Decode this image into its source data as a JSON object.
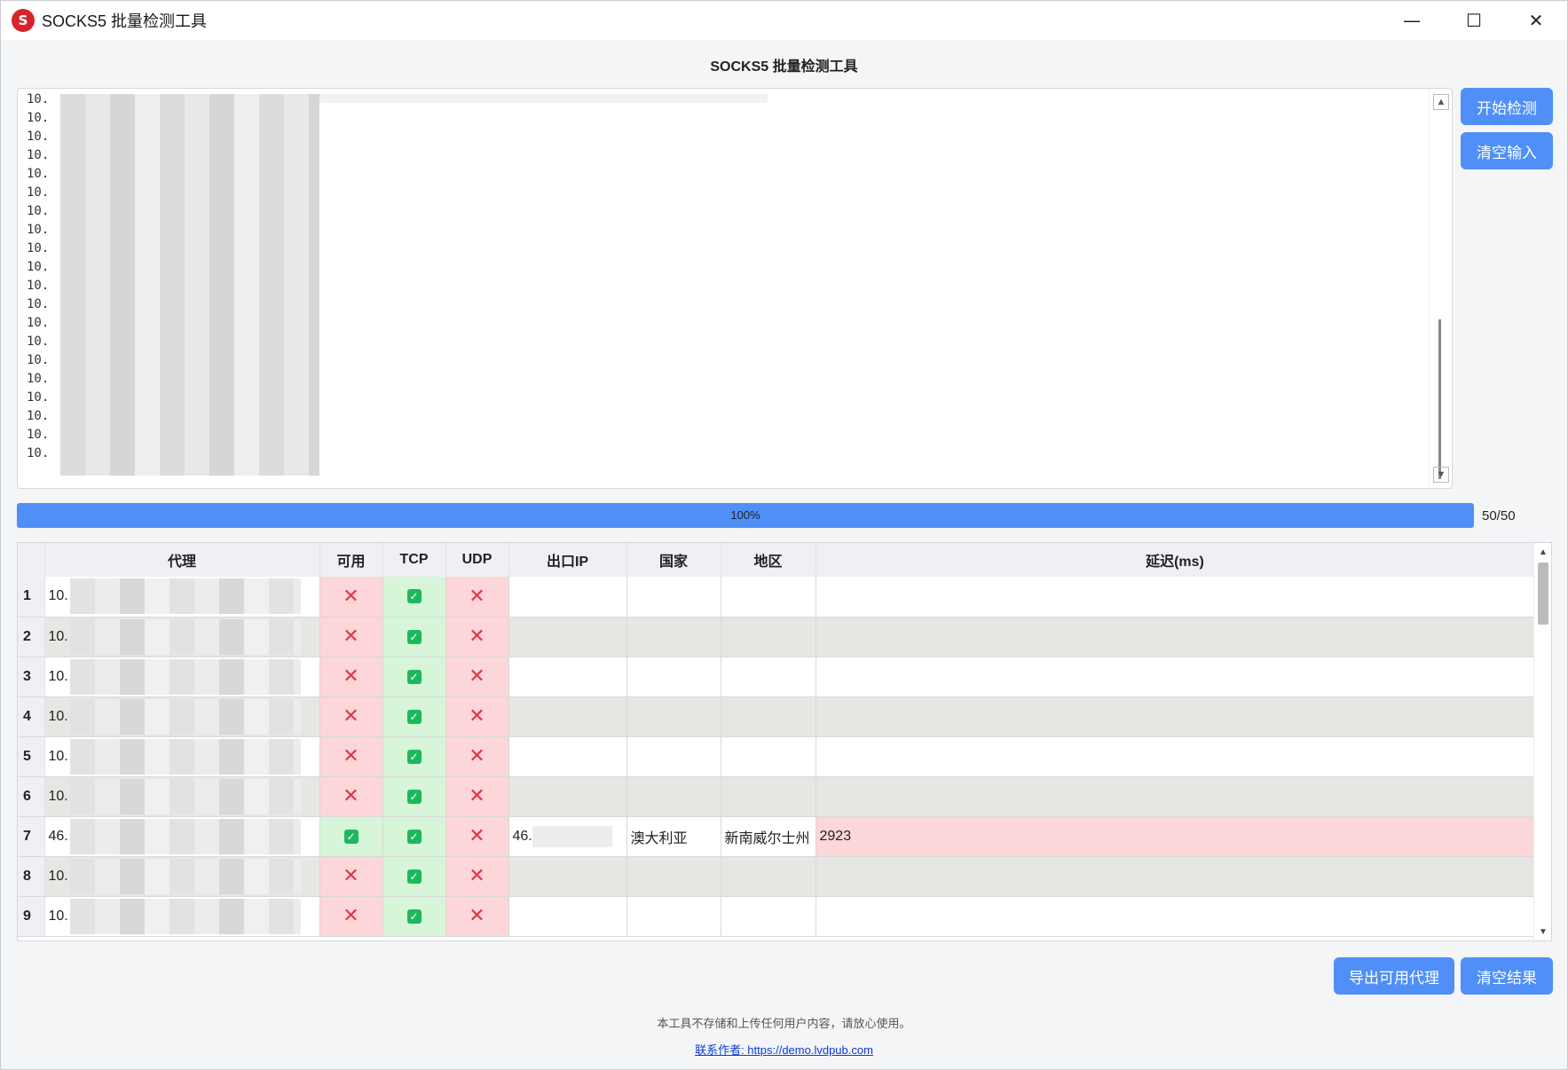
{
  "window": {
    "title": "SOCKS5 批量检测工具",
    "app_icon": "socks-logo-icon",
    "controls": {
      "minimize": "—",
      "maximize": "☐",
      "close": "✕"
    }
  },
  "heading": "SOCKS5 批量检测工具",
  "input": {
    "line_prefix": "10.",
    "line_count": 20
  },
  "buttons": {
    "start": "开始检测",
    "clear_input": "清空输入",
    "export": "导出可用代理",
    "clear_results": "清空结果"
  },
  "progress": {
    "percent_text": "100%",
    "value": 1.0,
    "count_text": "50/50"
  },
  "table": {
    "headers": [
      "代理",
      "可用",
      "TCP",
      "UDP",
      "出口IP",
      "国家",
      "地区",
      "延迟(ms)"
    ],
    "rows": [
      {
        "num": "1",
        "proxy": "10.",
        "available": false,
        "tcp": true,
        "udp": false,
        "exit_ip": "",
        "country": "",
        "region": "",
        "latency": ""
      },
      {
        "num": "2",
        "proxy": "10.",
        "available": false,
        "tcp": true,
        "udp": false,
        "exit_ip": "",
        "country": "",
        "region": "",
        "latency": ""
      },
      {
        "num": "3",
        "proxy": "10.",
        "available": false,
        "tcp": true,
        "udp": false,
        "exit_ip": "",
        "country": "",
        "region": "",
        "latency": ""
      },
      {
        "num": "4",
        "proxy": "10.",
        "available": false,
        "tcp": true,
        "udp": false,
        "exit_ip": "",
        "country": "",
        "region": "",
        "latency": ""
      },
      {
        "num": "5",
        "proxy": "10.",
        "available": false,
        "tcp": true,
        "udp": false,
        "exit_ip": "",
        "country": "",
        "region": "",
        "latency": ""
      },
      {
        "num": "6",
        "proxy": "10.",
        "available": false,
        "tcp": true,
        "udp": false,
        "exit_ip": "",
        "country": "",
        "region": "",
        "latency": ""
      },
      {
        "num": "7",
        "proxy": "46.",
        "available": true,
        "tcp": true,
        "udp": false,
        "exit_ip": "46.",
        "country": "澳大利亚",
        "region": "新南威尔士州",
        "latency": "2923"
      },
      {
        "num": "8",
        "proxy": "10.",
        "available": false,
        "tcp": true,
        "udp": false,
        "exit_ip": "",
        "country": "",
        "region": "",
        "latency": ""
      },
      {
        "num": "9",
        "proxy": "10.",
        "available": false,
        "tcp": true,
        "udp": false,
        "exit_ip": "",
        "country": "",
        "region": "",
        "latency": ""
      }
    ]
  },
  "footer": {
    "note": "本工具不存储和上传任何用户内容，请放心使用。",
    "link_label": "联系作者: ",
    "link_url": "https://demo.lvdpub.com"
  },
  "colors": {
    "accent": "#4f8ff7",
    "fail_bg": "#fcd6d9",
    "ok_bg": "#d6f5d9",
    "fail_mark": "#e2344b",
    "ok_mark": "#1eb85c"
  }
}
